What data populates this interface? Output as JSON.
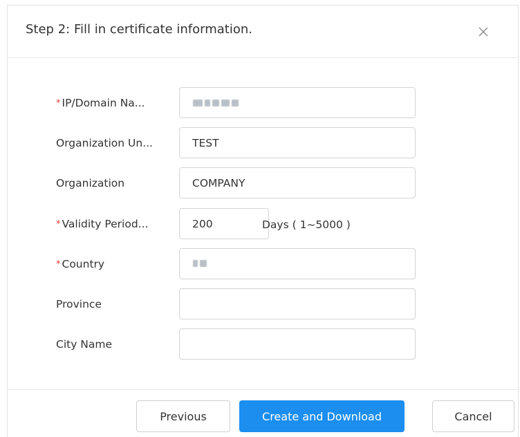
{
  "dialog": {
    "title": "Step 2: Fill in certificate information.",
    "close_icon": "close-icon"
  },
  "form": {
    "required_marker": "*",
    "fields": [
      {
        "label": "IP/Domain Na...",
        "required": true,
        "value": "",
        "redacted": true
      },
      {
        "label": "Organization Un...",
        "required": false,
        "value": "TEST"
      },
      {
        "label": "Organization",
        "required": false,
        "value": "COMPANY"
      },
      {
        "label": "Validity Period...",
        "required": true,
        "value": "200"
      },
      {
        "label": "Country",
        "required": true,
        "value": "",
        "redacted": true
      },
      {
        "label": "Province",
        "required": false,
        "value": ""
      },
      {
        "label": "City Name",
        "required": false,
        "value": ""
      }
    ],
    "validity_hint": "Days ( 1~5000 )"
  },
  "footer": {
    "previous_label": "Previous",
    "create_label": "Create and Download",
    "cancel_label": "Cancel"
  },
  "colors": {
    "primary": "#1b8ef0",
    "required": "#e4393c",
    "border": "#d4d4d4"
  }
}
